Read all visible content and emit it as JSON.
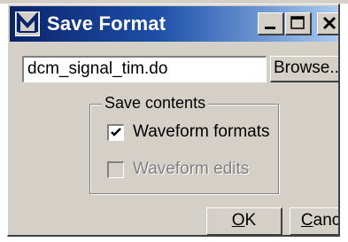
{
  "window": {
    "title": "Save Format",
    "icon": "m-app-icon"
  },
  "titlebar_buttons": {
    "minimize": "minimize-icon",
    "maximize": "maximize-icon",
    "close": "close-icon"
  },
  "file": {
    "value": "dcm_signal_tim.do",
    "browse_label": "Browse..."
  },
  "save_contents": {
    "legend": "Save contents",
    "options": [
      {
        "label": "Waveform formats",
        "checked": true,
        "enabled": true
      },
      {
        "label": "Waveform edits",
        "checked": false,
        "enabled": false
      }
    ]
  },
  "buttons": {
    "ok_mnemonic": "O",
    "ok_rest": "K",
    "cancel_mnemonic": "C",
    "cancel_rest": "ancel"
  },
  "colors": {
    "title_start": "#0a246a",
    "title_end": "#a6caf0",
    "face": "#d4d0c8"
  }
}
